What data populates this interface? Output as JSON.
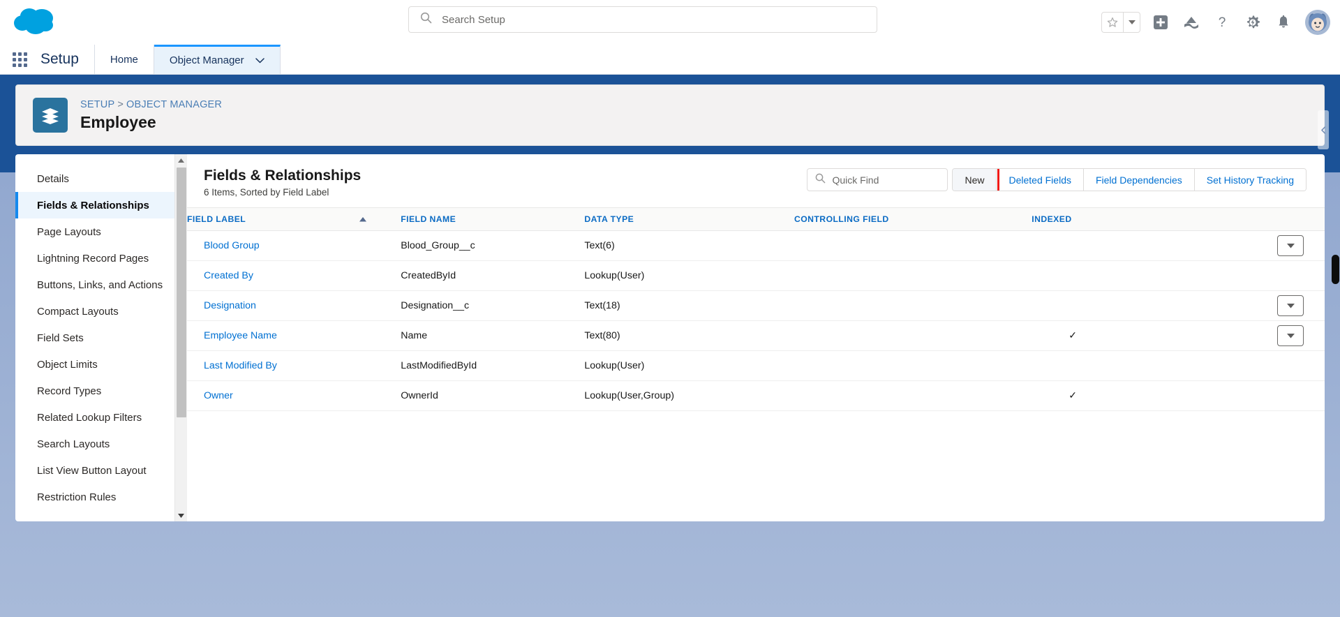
{
  "header": {
    "logo_name": "salesforce-cloud-logo",
    "search": {
      "placeholder": "Search Setup",
      "value": "",
      "icon": "search-icon"
    },
    "icons": [
      {
        "name": "favorites-star-icon",
        "glyph": "star"
      },
      {
        "name": "favorites-dropdown-icon",
        "glyph": "caret-down"
      },
      {
        "name": "global-actions-icon",
        "glyph": "plus-square"
      },
      {
        "name": "trailhead-icon",
        "glyph": "mountain"
      },
      {
        "name": "help-icon",
        "glyph": "question"
      },
      {
        "name": "setup-gear-icon",
        "glyph": "gear-bolt"
      },
      {
        "name": "notifications-bell-icon",
        "glyph": "bell"
      },
      {
        "name": "user-avatar",
        "glyph": "astro-avatar"
      }
    ]
  },
  "setup_bar": {
    "app_launcher": "app-launcher-waffle",
    "app_name": "Setup",
    "tabs": [
      {
        "label": "Home",
        "active": false,
        "has_caret": false
      },
      {
        "label": "Object Manager",
        "active": true,
        "has_caret": true
      }
    ]
  },
  "record_header": {
    "icon": "object-layers-icon",
    "breadcrumb": {
      "root": "SETUP",
      "separator": ">",
      "current": "OBJECT MANAGER"
    },
    "title": "Employee"
  },
  "sidebar": {
    "items": [
      {
        "label": "Details",
        "active": false
      },
      {
        "label": "Fields & Relationships",
        "active": true
      },
      {
        "label": "Page Layouts",
        "active": false
      },
      {
        "label": "Lightning Record Pages",
        "active": false
      },
      {
        "label": "Buttons, Links, and Actions",
        "active": false
      },
      {
        "label": "Compact Layouts",
        "active": false
      },
      {
        "label": "Field Sets",
        "active": false
      },
      {
        "label": "Object Limits",
        "active": false
      },
      {
        "label": "Record Types",
        "active": false
      },
      {
        "label": "Related Lookup Filters",
        "active": false
      },
      {
        "label": "Search Layouts",
        "active": false
      },
      {
        "label": "List View Button Layout",
        "active": false
      },
      {
        "label": "Restriction Rules",
        "active": false
      }
    ]
  },
  "main": {
    "title": "Fields & Relationships",
    "subtitle": "6 Items, Sorted by Field Label",
    "quick_find": {
      "placeholder": "Quick Find",
      "value": "",
      "icon": "search-icon"
    },
    "buttons": [
      {
        "label": "New",
        "primary": true,
        "highlighted": true
      },
      {
        "label": "Deleted Fields",
        "primary": false,
        "highlighted": false
      },
      {
        "label": "Field Dependencies",
        "primary": false,
        "highlighted": false
      },
      {
        "label": "Set History Tracking",
        "primary": false,
        "highlighted": false
      }
    ],
    "highlight_color": "#f01a18",
    "table": {
      "columns": [
        {
          "label": "FIELD LABEL",
          "sorted": true,
          "sort_dir": "asc"
        },
        {
          "label": "FIELD NAME",
          "sorted": false
        },
        {
          "label": "DATA TYPE",
          "sorted": false
        },
        {
          "label": "CONTROLLING FIELD",
          "sorted": false
        },
        {
          "label": "INDEXED",
          "sorted": false
        }
      ],
      "rows": [
        {
          "field_label": "Blood Group",
          "field_name": "Blood_Group__c",
          "data_type": "Text(6)",
          "controlling_field": "",
          "indexed": "",
          "has_row_menu": true
        },
        {
          "field_label": "Created By",
          "field_name": "CreatedById",
          "data_type": "Lookup(User)",
          "controlling_field": "",
          "indexed": "",
          "has_row_menu": false
        },
        {
          "field_label": "Designation",
          "field_name": "Designation__c",
          "data_type": "Text(18)",
          "controlling_field": "",
          "indexed": "",
          "has_row_menu": true
        },
        {
          "field_label": "Employee Name",
          "field_name": "Name",
          "data_type": "Text(80)",
          "controlling_field": "",
          "indexed": "✓",
          "has_row_menu": true
        },
        {
          "field_label": "Last Modified By",
          "field_name": "LastModifiedById",
          "data_type": "Lookup(User)",
          "controlling_field": "",
          "indexed": "",
          "has_row_menu": false
        },
        {
          "field_label": "Owner",
          "field_name": "OwnerId",
          "data_type": "Lookup(User,Group)",
          "controlling_field": "",
          "indexed": "✓",
          "has_row_menu": false
        }
      ]
    }
  },
  "colors": {
    "brand_blue": "#0070d2",
    "header_blue": "#1b5297",
    "active_nav": "#1589ee",
    "link": "#0070d2",
    "highlight_red": "#f01a18"
  }
}
